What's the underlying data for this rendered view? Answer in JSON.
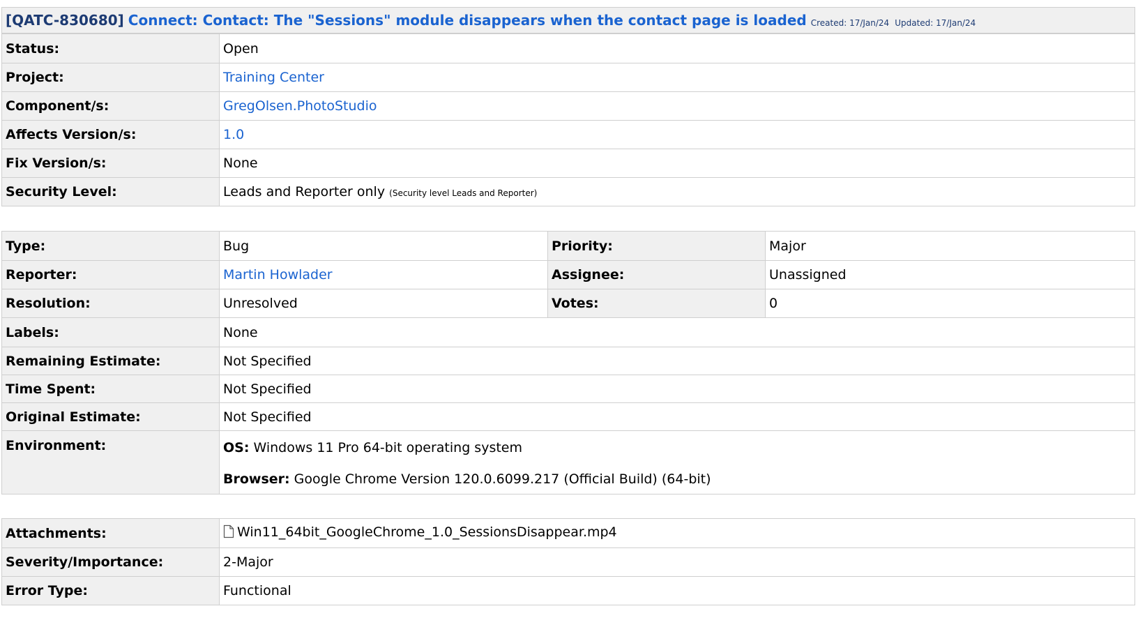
{
  "header": {
    "issue_key": "[QATC-830680]",
    "summary": "Connect: Contact: The \"Sessions\" module disappears when the contact page is loaded",
    "created": "Created: 17/Jan/24",
    "updated": "Updated: 17/Jan/24"
  },
  "details": {
    "status_label": "Status:",
    "status_value": "Open",
    "project_label": "Project:",
    "project_value": "Training Center",
    "component_label": "Component/s:",
    "component_value": "GregOlsen.PhotoStudio",
    "affects_label": "Affects Version/s:",
    "affects_value": "1.0",
    "fix_label": "Fix Version/s:",
    "fix_value": "None",
    "security_label": "Security Level:",
    "security_value": "Leads and Reporter only",
    "security_note": "(Security level Leads and Reporter)"
  },
  "people": {
    "type_label": "Type:",
    "type_value": "Bug",
    "priority_label": "Priority:",
    "priority_value": "Major",
    "reporter_label": "Reporter:",
    "reporter_value": "Martin Howlader",
    "assignee_label": "Assignee:",
    "assignee_value": "Unassigned",
    "resolution_label": "Resolution:",
    "resolution_value": "Unresolved",
    "votes_label": "Votes:",
    "votes_value": "0",
    "labels_label": "Labels:",
    "labels_value": "None",
    "remaining_label": "Remaining Estimate:",
    "remaining_value": "Not Specified",
    "timespent_label": "Time Spent:",
    "timespent_value": "Not Specified",
    "original_label": "Original Estimate:",
    "original_value": "Not Specified",
    "environment_label": "Environment:",
    "os_label": "OS:",
    "os_value": "Windows 11 Pro 64-bit operating system",
    "browser_label": "Browser:",
    "browser_value": "Google Chrome Version 120.0.6099.217 (Official Build) (64-bit)"
  },
  "extra": {
    "attachments_label": "Attachments:",
    "attachment_file": "Win11_64bit_GoogleChrome_1.0_SessionsDisappear.mp4",
    "severity_label": "Severity/Importance:",
    "severity_value": "2-Major",
    "error_label": "Error Type:",
    "error_value": "Functional"
  },
  "icons": {
    "attachment": "file-icon"
  },
  "colors": {
    "link": "#1a63d0",
    "label_bg": "#f0f0f0",
    "border": "#cfcfcf",
    "key": "#1d3b73"
  }
}
